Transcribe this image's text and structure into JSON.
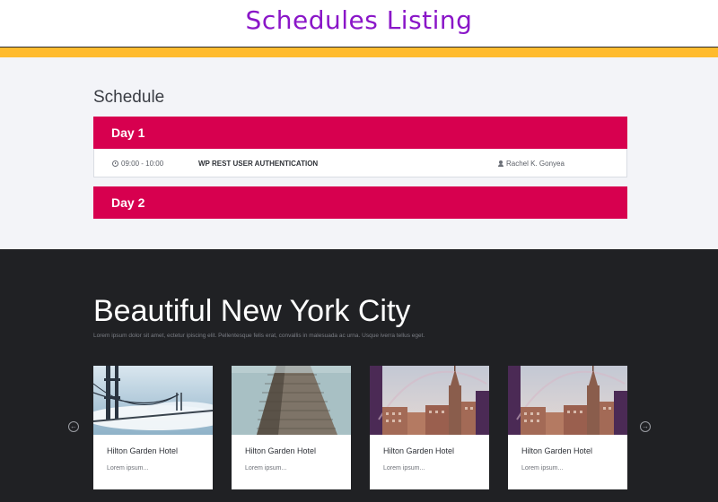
{
  "banner": {
    "title": "Schedules Listing"
  },
  "schedule": {
    "heading": "Schedule",
    "days": [
      {
        "label": "Day 1",
        "sessions": [
          {
            "time": "09:00 - 10:00",
            "title": "WP REST USER AUTHENTICATION",
            "speaker": "Rachel K. Gonyea"
          }
        ]
      },
      {
        "label": "Day 2"
      }
    ]
  },
  "city": {
    "title": "Beautiful New York City",
    "description": "Lorem ipsum dolor sit amet, ectetur ipiscing elit. Pellentesque felis erat, convallis in malesuada ac urna. Usque iverra tellus eget.",
    "cards": [
      {
        "title": "Hilton Garden Hotel",
        "text": "Lorem ipsum..."
      },
      {
        "title": "Hilton Garden Hotel",
        "text": "Lorem ipsum..."
      },
      {
        "title": "Hilton Garden Hotel",
        "text": "Lorem ipsum..."
      },
      {
        "title": "Hilton Garden Hotel",
        "text": "Lorem ipsum..."
      }
    ],
    "prev_icon": "arrow-left-circle-icon",
    "next_icon": "arrow-right-circle-icon"
  },
  "colors": {
    "banner_title": "#8a16c8",
    "accent_bar": "#ffbb2e",
    "day_header": "#d7004f",
    "dark_section": "#202124",
    "light_section": "#f3f4f8"
  }
}
